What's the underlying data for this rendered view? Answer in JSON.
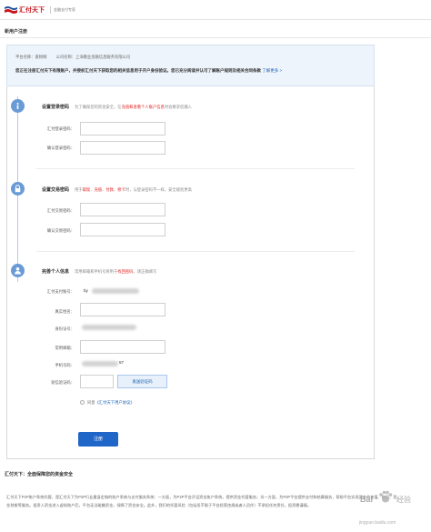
{
  "header": {
    "brand": "汇付天下",
    "slogan": "金融支付专家"
  },
  "page": {
    "title": "新用户注册"
  },
  "notice": {
    "platform_label": "平台名称：爱财网",
    "company_label": "公司名称：上海敬业金融信息服务有限公司",
    "main_text": "您正在注册汇付天下有限账户，并授权汇付天下获取您的相关信息用于开户身份验证。您已充分阅读并认可了解账户规则及相关合同条款",
    "link": "了解更多 >"
  },
  "section1": {
    "title": "设置登录密码",
    "desc_pre": "为了确保您的资金安全，在",
    "desc_red": "充值和查看个人账户信息",
    "desc_post": "时会要求您输入",
    "label_password": "汇付登录密码：",
    "label_confirm": "确认登录密码："
  },
  "section2": {
    "title": "设置交易密码",
    "desc_pre": "用于",
    "desc_red1": "取现",
    "desc_sep1": "、",
    "desc_red2": "充值",
    "desc_sep2": "、",
    "desc_red3": "付款",
    "desc_sep3": "、",
    "desc_red4": "修卡",
    "desc_post": "时，与登录密码不一样，安全级别更高",
    "label_password": "汇付交易密码：",
    "label_confirm": "确认交易密码："
  },
  "section3": {
    "title": "完善个人信息",
    "desc_pre": "常用邮箱和手机号将用于",
    "desc_red": "找回密码",
    "desc_post": "，请正确填写",
    "label_account": "汇付支付账号：",
    "account_value": "by",
    "label_name": "真实姓名：",
    "label_id": "身份证号：",
    "label_email": "常用邮箱：",
    "label_phone": "手机号码：",
    "phone_tail": "57",
    "label_sms": "短信验证码：",
    "sms_button": "发送验证码",
    "agree_pre": "同意",
    "agree_link": "《汇付天下用户协议》",
    "submit": "注册"
  },
  "footer": {
    "title": "汇付天下：全面保障您的资金安全",
    "text": "汇付天下P2P账户系统托管，是汇付天下为P2P行业量身定制的账户系统与支付服务系统：一方面，为P2P平台开设资金账户系统，提供资金托管服务；另一方面，为P2P平台提供支付和结算服务，帮助平台实现资金的充值、取现、资金划拨等服务。投资人资金进入虚拟账户后，平台无法碰触资金，保障了资金安全。此外，我们的托管风险（包括但不限于平台经营违规或者人员作）不承担任何责任，投资需谨慎。"
  },
  "watermark": {
    "line1": "Bai",
    "line2": "经验",
    "line3": "jingyan.baidu.com"
  },
  "colors": {
    "brand_red": "#c8161d",
    "accent_blue": "#1f66c8",
    "step_icon": "#6a9bd6"
  }
}
